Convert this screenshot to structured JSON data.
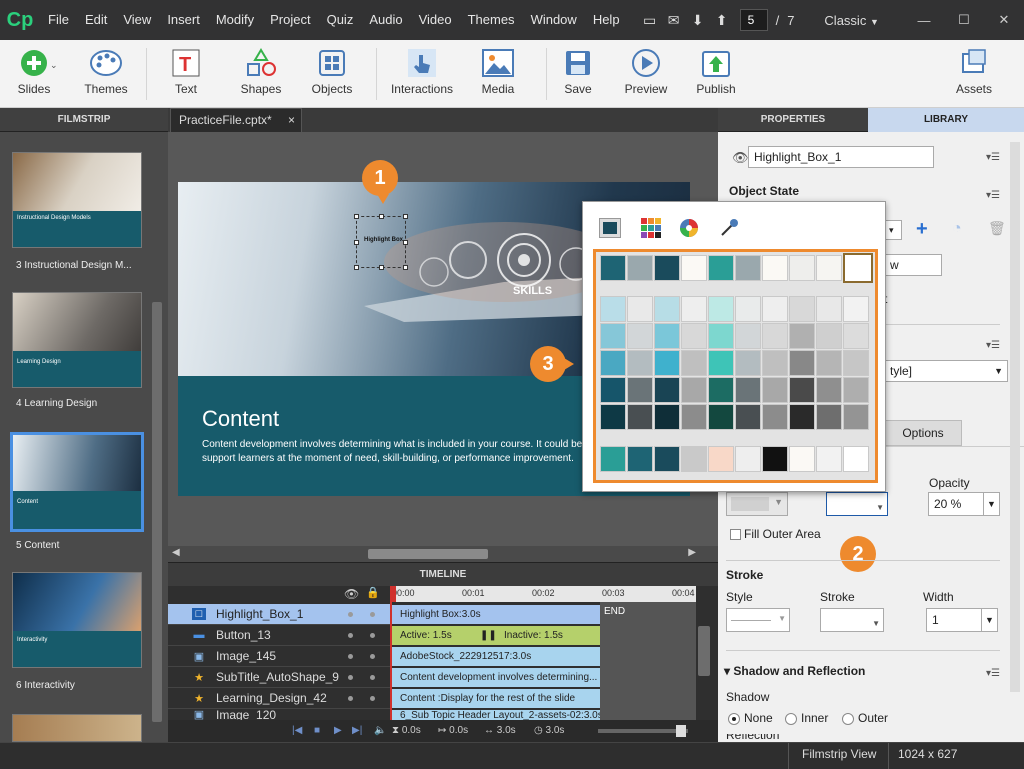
{
  "menubar": {
    "logo": "Cp",
    "items": [
      "File",
      "Edit",
      "View",
      "Insert",
      "Modify",
      "Project",
      "Quiz",
      "Audio",
      "Video",
      "Themes",
      "Window",
      "Help"
    ],
    "page_current": "5",
    "page_sep": "/",
    "page_total": "7",
    "workspace": "Classic"
  },
  "toolbar": {
    "slides": "Slides",
    "themes": "Themes",
    "text": "Text",
    "shapes": "Shapes",
    "objects": "Objects",
    "interactions": "Interactions",
    "media": "Media",
    "save": "Save",
    "preview": "Preview",
    "publish": "Publish",
    "assets": "Assets"
  },
  "filmstrip": {
    "header": "FILMSTRIP",
    "slides": [
      {
        "label": "3 Instructional Design M...",
        "title": "Instructional Design Models"
      },
      {
        "label": "4 Learning Design",
        "title": "Learning Design"
      },
      {
        "label": "5 Content",
        "title": "Content"
      },
      {
        "label": "6 Interactivity",
        "title": "Interactivity"
      }
    ]
  },
  "document": {
    "tab": "PracticeFile.cptx*",
    "close": "×"
  },
  "slide": {
    "highlight_label": "Highlight Box",
    "skills": "SKILLS",
    "title": "Content",
    "body": "Content development involves determining what is included in your course. It could be to support learners at the moment of need, skill-building, or performance improvement."
  },
  "timeline": {
    "header": "TIMELINE",
    "ruler": [
      "00:00",
      "00:01",
      "00:02",
      "00:03",
      "00:04"
    ],
    "end": "END",
    "rows": [
      {
        "name": "Highlight_Box_1",
        "bar": "Highlight Box:3.0s"
      },
      {
        "name": "Button_13",
        "bar": "Active: 1.5s",
        "bar2": "Inactive: 1.5s"
      },
      {
        "name": "Image_145",
        "bar": "AdobeStock_222912517:3.0s"
      },
      {
        "name": "SubTitle_AutoShape_9",
        "bar": "Content development involves determining..."
      },
      {
        "name": "Learning_Design_42",
        "bar": "Content :Display for the rest of the slide"
      },
      {
        "name": "Image_120",
        "bar": "6_Sub Topic Header Layout_2-assets-02:3.0s"
      }
    ],
    "footer": {
      "t1": "0.0s",
      "t2": "0.0s",
      "t3": "3.0s",
      "t4": "3.0s"
    }
  },
  "properties": {
    "tab_properties": "PROPERTIES",
    "tab_library": "LIBRARY",
    "object_name": "Highlight_Box_1",
    "object_state": "Object State",
    "partial_w": "w",
    "partial_t": "t",
    "partial_style": "tyle]",
    "options_tab": "Options",
    "opacity_label": "Opacity",
    "opacity_value": "20 %",
    "fill_outer": "Fill Outer Area",
    "stroke_header": "Stroke",
    "style_label": "Style",
    "stroke_label": "Stroke",
    "width_label": "Width",
    "width_value": "1",
    "shadow_header": "Shadow and Reflection",
    "shadow_label": "Shadow",
    "shadow_none": "None",
    "shadow_inner": "Inner",
    "shadow_outer": "Outer",
    "reflection_partial": "Reflection"
  },
  "callouts": {
    "c1": "1",
    "c2": "2",
    "c3": "3"
  },
  "status": {
    "view": "Filmstrip View",
    "size": "1024 x 627"
  },
  "colors": {
    "row1": [
      "#1e6474",
      "#9aa8ad",
      "#1a4b5c",
      "#fbf9f5",
      "#2a9e96",
      "#9aa8ad",
      "#fbf9f5",
      "#eeeeec",
      "#f6f5f2",
      "#ffffff"
    ],
    "row2": [
      "#b9dde8",
      "#e9e9e9",
      "#b7dde6",
      "#eeeeee",
      "#bde9e5",
      "#e9ebeb",
      "#eeeeee",
      "#d8d8d8",
      "#e8e8e8",
      "#f2f2f2"
    ],
    "row3": [
      "#86c7d8",
      "#d2d6d8",
      "#7bc7d9",
      "#d8d8d8",
      "#7dd7cf",
      "#d2d6d8",
      "#d8d8d8",
      "#b0b0b0",
      "#cfcfcf",
      "#dcdcdc"
    ],
    "row4": [
      "#4aa8c2",
      "#b3bcc0",
      "#3fb1cd",
      "#bfbfbf",
      "#3ec4b7",
      "#b3bcc0",
      "#bfbfbf",
      "#888888",
      "#b5b5b5",
      "#c6c6c6"
    ],
    "row5": [
      "#16556a",
      "#6a7478",
      "#194454",
      "#a8a8a8",
      "#1c6c63",
      "#6a7478",
      "#a8a8a8",
      "#4a4a4a",
      "#8f8f8f",
      "#aeaeae"
    ],
    "row6": [
      "#0e3945",
      "#494f52",
      "#0f2e38",
      "#8c8c8c",
      "#13483f",
      "#494f52",
      "#8c8c8c",
      "#2a2a2a",
      "#6e6e6e",
      "#949494"
    ],
    "recent": [
      "#2a9e96",
      "#1e6474",
      "#1a4b5c",
      "#c9c9c9",
      "#f8d8c8",
      "#eeeeee",
      "#111111",
      "#fbf9f5",
      "#f2f2f2",
      "#ffffff"
    ],
    "accent": "#ee8a2e"
  }
}
